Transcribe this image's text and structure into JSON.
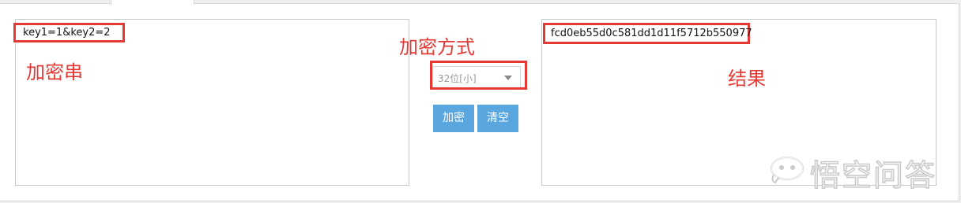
{
  "input": {
    "value": "key1=1&key2=2",
    "annotation": "加密串"
  },
  "controls": {
    "annotation": "加密方式",
    "mode_select_value": "32位[小]",
    "encrypt_label": "加密",
    "clear_label": "清空"
  },
  "result": {
    "value": "fcd0eb55d0c581dd1d11f5712b550977",
    "annotation": "结果"
  },
  "watermark": {
    "text": "悟空问答"
  },
  "colors": {
    "annotation_red": "#e53935",
    "button_blue": "#5aa7e0"
  },
  "icons": {
    "select_caret": "caret-down-icon",
    "watermark_logo": "wukong-logo-icon"
  }
}
